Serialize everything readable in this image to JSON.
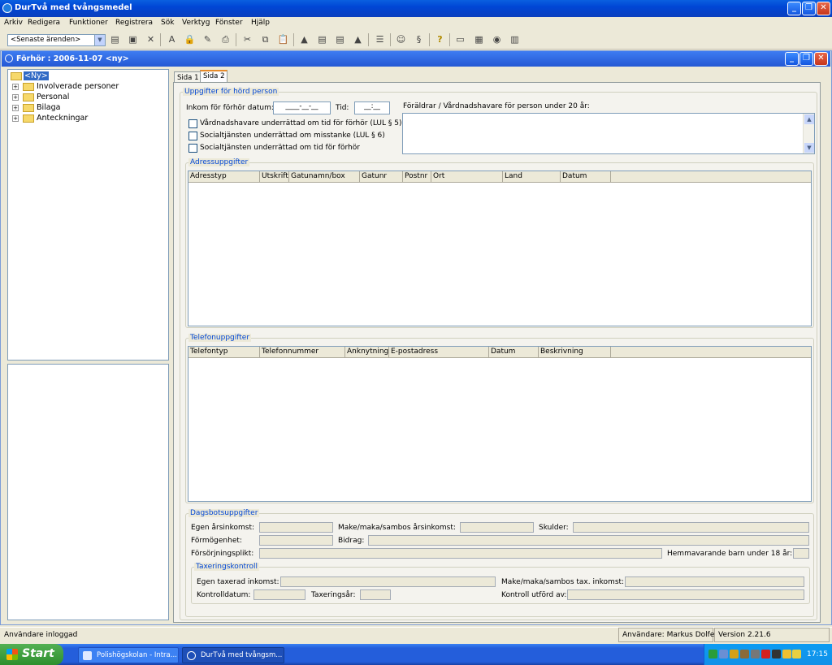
{
  "window": {
    "title": "DurTvå med tvångsmedel"
  },
  "menu": [
    "Arkiv",
    "Redigera",
    "Funktioner",
    "Registrera",
    "Sök",
    "Verktyg",
    "Fönster",
    "Hjälp"
  ],
  "toolbar": {
    "recent_combo": "<Senaste ärenden>"
  },
  "child": {
    "title": "Förhör : 2006-11-07 <ny>"
  },
  "tree": {
    "root": "<Ny>",
    "items": [
      "Involverade personer",
      "Personal",
      "Bilaga",
      "Anteckningar"
    ]
  },
  "tabs": [
    "Sida 1",
    "Sida 2"
  ],
  "heard_person": {
    "group": "Uppgifter för hörd person",
    "received_label": "Inkom för förhör datum:",
    "received_value": "____-__-__",
    "time_label": "Tid:",
    "time_value": "__:__",
    "checks": [
      "Vårdnadshavare underrättad om tid för förhör (LUL § 5)",
      "Socialtjänsten underrättad om misstanke (LUL § 6)",
      "Socialtjänsten underrättad om tid för förhör"
    ],
    "parents_label": "Föräldrar / Vårdnadshavare för person under 20 år:"
  },
  "address": {
    "group": "Adressuppgifter",
    "columns": [
      "Adresstyp",
      "Utskrift",
      "Gatunamn/box",
      "Gatunr",
      "Postnr",
      "Ort",
      "Land",
      "Datum"
    ]
  },
  "phone": {
    "group": "Telefonuppgifter",
    "columns": [
      "Telefontyp",
      "Telefonnummer",
      "Anknytning",
      "E-postadress",
      "Datum",
      "Beskrivning"
    ]
  },
  "fines": {
    "group": "Dagsbotsuppgifter",
    "own_income": "Egen årsinkomst:",
    "spouse_income": "Make/maka/sambos årsinkomst:",
    "debts": "Skulder:",
    "assets": "Förmögenhet:",
    "allowance": "Bidrag:",
    "support": "Försörjningsplikt:",
    "children": "Hemmavarande barn under 18 år:"
  },
  "tax": {
    "group": "Taxeringskontroll",
    "own_taxed": "Egen taxerad inkomst:",
    "spouse_taxed": "Make/maka/sambos tax. inkomst:",
    "control_date": "Kontrolldatum:",
    "tax_year": "Taxeringsår:",
    "control_by": "Kontroll utförd av:"
  },
  "status": {
    "left": "Användare inloggad",
    "user": "Användare: Markus Dolfe",
    "version": "Version 2.21.6"
  },
  "taskbar": {
    "start": "Start",
    "tasks": [
      "Polishögskolan - Intra...",
      "DurTvå med tvångsm..."
    ],
    "clock": "17:15"
  }
}
